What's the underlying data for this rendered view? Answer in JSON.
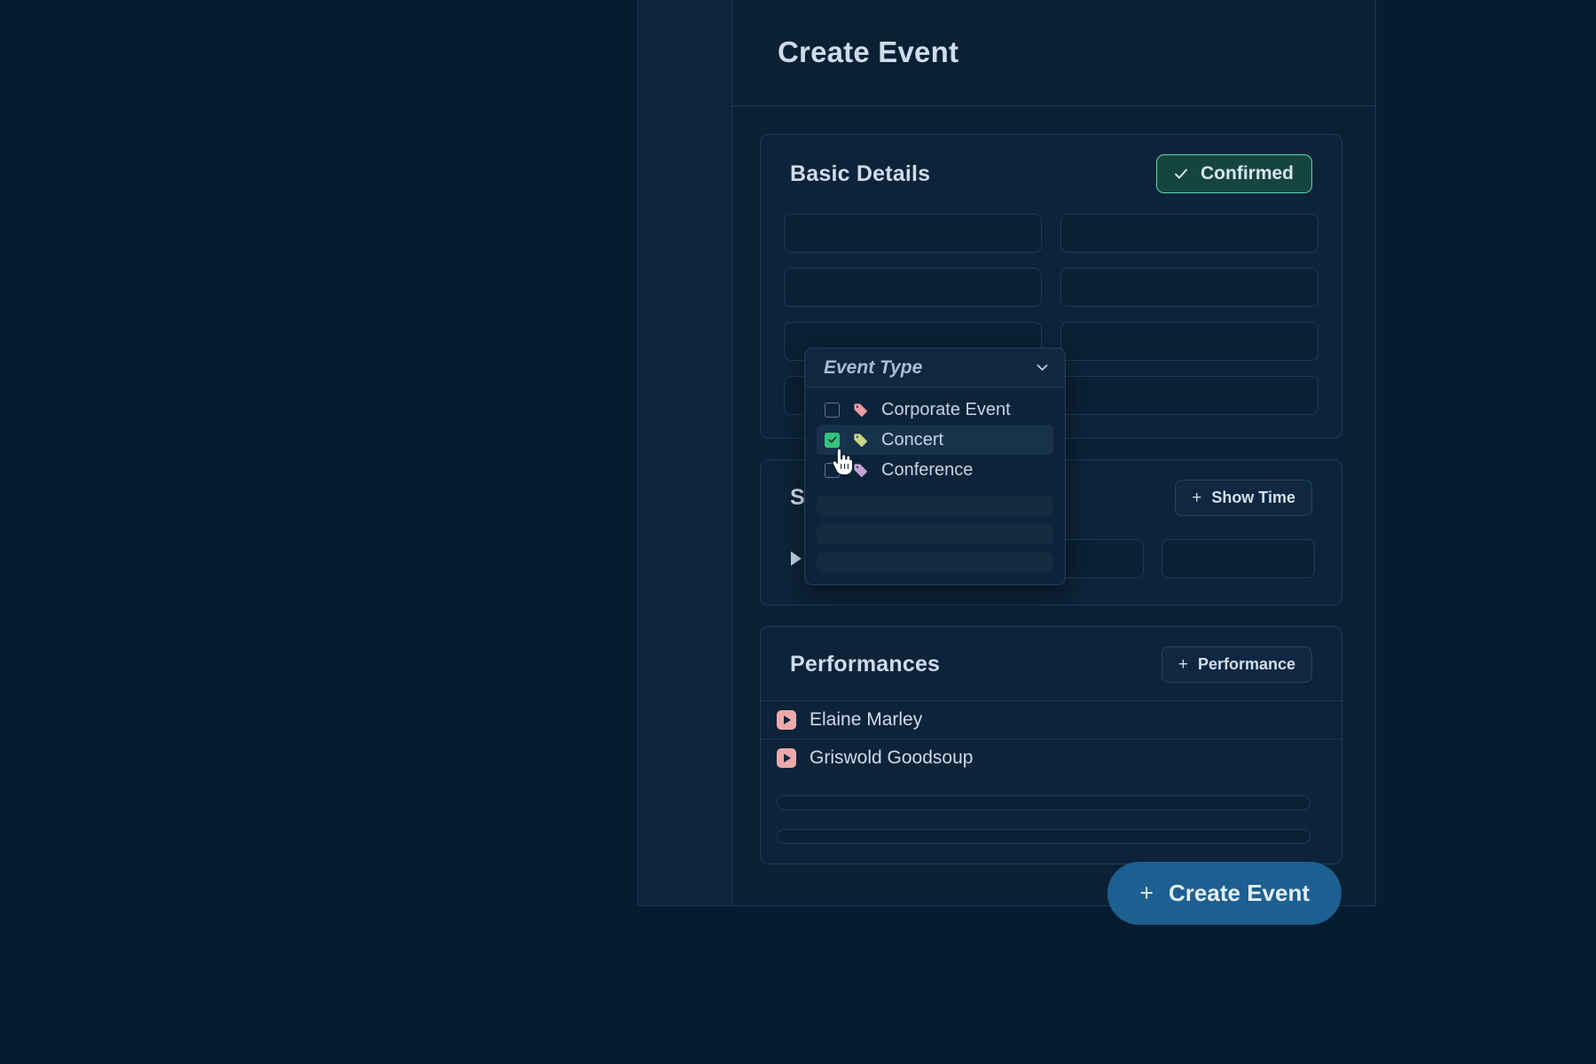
{
  "header": {
    "title": "Create Event"
  },
  "basic_details": {
    "title": "Basic Details",
    "status_badge": {
      "label": "Confirmed",
      "icon": "check-icon",
      "border_color": "#5fd6a4",
      "bg_color": "#16453f"
    },
    "event_type_select": {
      "placeholder": "Event Type",
      "value": "",
      "chevron_icon": "chevron-down-icon",
      "open": true,
      "options": [
        {
          "label": "Corporate Event",
          "checked": false,
          "tag_icon": "tag-icon",
          "tag_color": "#ea9ca0"
        },
        {
          "label": "Concert",
          "checked": true,
          "tag_icon": "tag-icon",
          "tag_color": "#cad585"
        },
        {
          "label": "Conference",
          "checked": false,
          "tag_icon": "tag-icon",
          "tag_color": "#c3a3d6"
        }
      ],
      "skeleton_rows": 3
    },
    "empty_fields": 7
  },
  "show_times": {
    "title": "Show Times",
    "add_button": {
      "label": "Show Time",
      "icon": "plus-icon"
    },
    "rows": [
      {
        "expand_icon": "play-triangle-icon",
        "fields": [
          "",
          "",
          ""
        ]
      }
    ]
  },
  "performances": {
    "title": "Performances",
    "add_button": {
      "label": "Performance",
      "icon": "plus-icon"
    },
    "items": [
      {
        "name": "Elaine Marley",
        "icon": "play-badge-icon",
        "icon_color": "#eda9ab"
      },
      {
        "name": "Griswold Goodsoup",
        "icon": "play-badge-icon",
        "icon_color": "#eda9ab"
      }
    ],
    "skeleton_rows": 2
  },
  "footer": {
    "create_button": {
      "label": "Create Event",
      "icon": "plus-icon",
      "bg_color": "#1d5f90"
    }
  },
  "cursor": {
    "type": "pointing-hand-cursor"
  }
}
